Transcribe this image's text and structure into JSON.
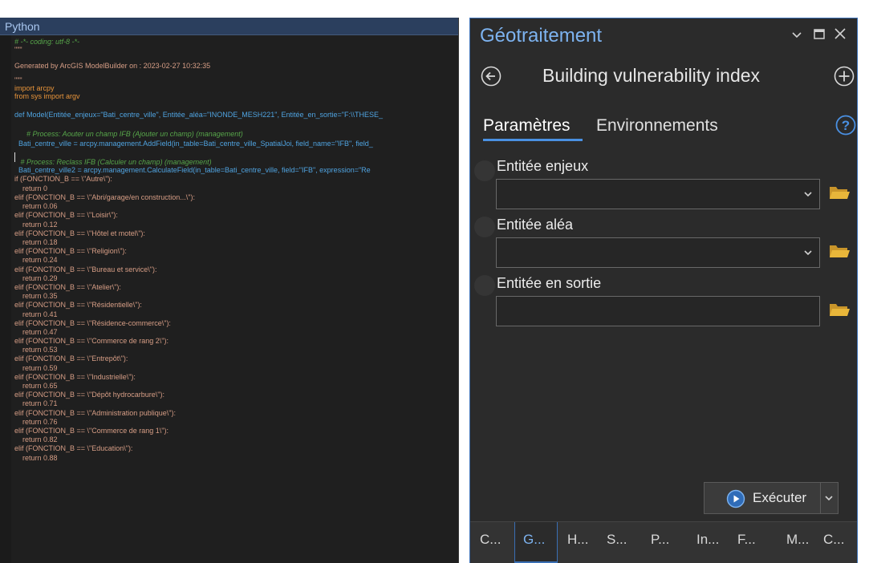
{
  "python": {
    "title": "Python",
    "lines": [
      {
        "t": "# -*- coding: utf-8 -*-",
        "c": "#57a64a",
        "i": true
      },
      {
        "t": "\"\"\"",
        "c": "#d69d85"
      },
      {
        "t": "Generated by ArcGIS ModelBuilder on : 2023-02-27 10:32:35",
        "c": "#d69d85"
      },
      {
        "t": "\"\"\"",
        "c": "#d69d85"
      },
      {
        "t": "import arcpy",
        "c": "#e8943a"
      },
      {
        "t": "from sys import argv",
        "c": "#e8943a"
      },
      {
        "t": "",
        "c": "#cccccc"
      },
      {
        "t": "def Model(Entitée_enjeux=\"Bati_centre_ville\", Entitée_aléa=\"INONDE_MESH221\", Entitée_en_sortie=\"F:\\\\THESE_",
        "c": "#4fa3e0"
      },
      {
        "t": "",
        "c": "#cccccc"
      },
      {
        "t": "      # Process: Aouter un champ IFB (Ajouter un champ) (management)",
        "c": "#57a64a",
        "i": true
      },
      {
        "t": "  Bati_centre_ville = arcpy.management.AddField(in_table=Bati_centre_ville_SpatialJoi, field_name=\"IFB\", field_",
        "c": "#4fa3e0"
      },
      {
        "t": "",
        "c": "#cccccc"
      },
      {
        "t": "   # Process: Reclass IFB (Calculer un champ) (management)",
        "c": "#57a64a",
        "i": true
      },
      {
        "t": "  Bati_centre_ville2 = arcpy.management.CalculateField(in_table=Bati_centre_ville, field=\"IFB\", expression=\"Re",
        "c": "#4fa3e0"
      },
      {
        "t": "if (FONCTION_B == \\\"Autre\\\"):",
        "c": "#d69d85"
      },
      {
        "t": "    return 0",
        "c": "#d69d85"
      },
      {
        "t": "elif (FONCTION_B == \\\"Abri/garage/en construction...\\\"):",
        "c": "#d69d85"
      },
      {
        "t": "    return 0.06",
        "c": "#d69d85"
      },
      {
        "t": "elif (FONCTION_B == \\\"Loisir\\\"):",
        "c": "#d69d85"
      },
      {
        "t": "    return 0.12",
        "c": "#d69d85"
      },
      {
        "t": "elif (FONCTION_B == \\\"Hôtel et motel\\\"):",
        "c": "#d69d85"
      },
      {
        "t": "    return 0.18",
        "c": "#d69d85"
      },
      {
        "t": "elif (FONCTION_B == \\\"Religion\\\"):",
        "c": "#d69d85"
      },
      {
        "t": "    return 0.24",
        "c": "#d69d85"
      },
      {
        "t": "elif (FONCTION_B == \\\"Bureau et service\\\"):",
        "c": "#d69d85"
      },
      {
        "t": "    return 0.29",
        "c": "#d69d85"
      },
      {
        "t": "elif (FONCTION_B == \\\"Atelier\\\"):",
        "c": "#d69d85"
      },
      {
        "t": "    return 0.35",
        "c": "#d69d85"
      },
      {
        "t": "elif (FONCTION_B == \\\"Résidentielle\\\"):",
        "c": "#d69d85"
      },
      {
        "t": "    return 0.41",
        "c": "#d69d85"
      },
      {
        "t": "elif (FONCTION_B == \\\"Résidence-commerce\\\"):",
        "c": "#d69d85"
      },
      {
        "t": "    return 0.47",
        "c": "#d69d85"
      },
      {
        "t": "elif (FONCTION_B == \\\"Commerce de rang 2\\\"):",
        "c": "#d69d85"
      },
      {
        "t": "    return 0.53",
        "c": "#d69d85"
      },
      {
        "t": "elif (FONCTION_B == \\\"Entrepôt\\\"):",
        "c": "#d69d85"
      },
      {
        "t": "    return 0.59",
        "c": "#d69d85"
      },
      {
        "t": "elif (FONCTION_B == \\\"Industrielle\\\"):",
        "c": "#d69d85"
      },
      {
        "t": "    return 0.65",
        "c": "#d69d85"
      },
      {
        "t": "elif (FONCTION_B == \\\"Dépôt hydrocarbure\\\"):",
        "c": "#d69d85"
      },
      {
        "t": "    return 0.71",
        "c": "#d69d85"
      },
      {
        "t": "elif (FONCTION_B == \\\"Administration publique\\\"):",
        "c": "#d69d85"
      },
      {
        "t": "    return 0.76",
        "c": "#d69d85"
      },
      {
        "t": "elif (FONCTION_B == \\\"Commerce de rang 1\\\"):",
        "c": "#d69d85"
      },
      {
        "t": "    return 0.82",
        "c": "#d69d85"
      },
      {
        "t": "elif (FONCTION_B == \\\"Education\\\"):",
        "c": "#d69d85"
      },
      {
        "t": "    return 0.88",
        "c": "#d69d85"
      }
    ]
  },
  "gp": {
    "title": "Géotraitement",
    "tool_title": "Building vulnerability index",
    "tabs": {
      "params": "Paramètres",
      "env": "Environnements"
    },
    "params": [
      {
        "label": "Entitée enjeux",
        "dropdown": true
      },
      {
        "label": "Entitée aléa",
        "dropdown": true
      },
      {
        "label": "Entitée en sortie",
        "dropdown": false
      }
    ],
    "run_label": "Exécuter",
    "bottom_tabs": [
      "C...",
      "G...",
      "H...",
      "S...",
      "P...",
      "In...",
      "F...",
      "M...",
      "C..."
    ],
    "accent": "#3a6fb5",
    "folder_color": "#e8b63a"
  }
}
